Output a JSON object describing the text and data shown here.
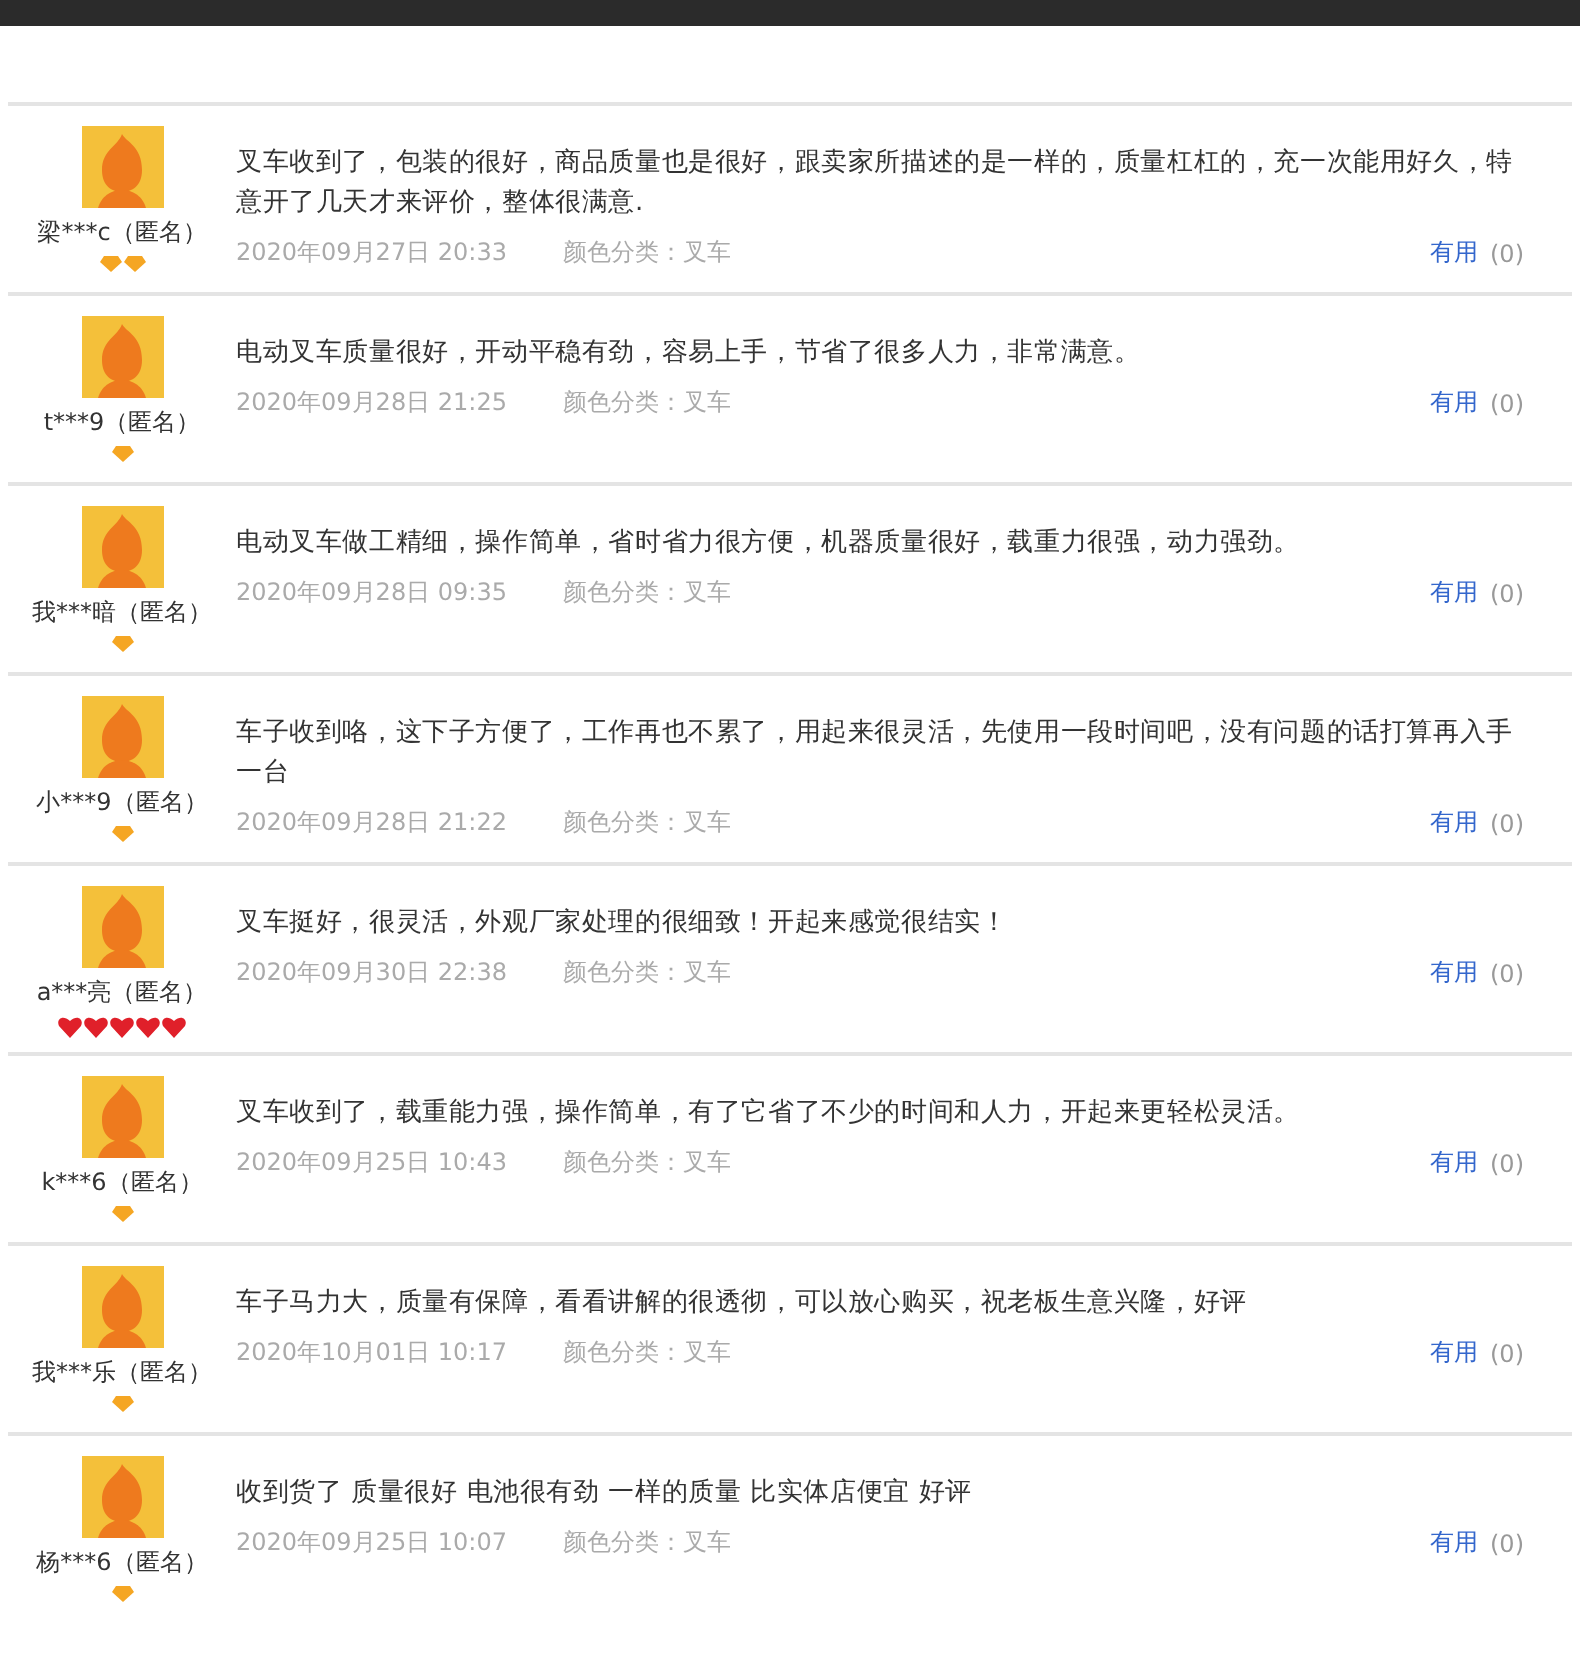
{
  "reviews": [
    {
      "user": "梁***c（匿名）",
      "badges": [
        {
          "kind": "diamond"
        },
        {
          "kind": "diamond"
        }
      ],
      "text": "叉车收到了，包装的很好，商品质量也是很好，跟卖家所描述的是一样的，质量杠杠的，充一次能用好久，特意开了几天才来评价，整体很满意.",
      "date": "2020年09月27日 20:33",
      "variant": "颜色分类：叉车",
      "useful": "有用",
      "useful_count": "(0)"
    },
    {
      "user": "t***9（匿名）",
      "badges": [
        {
          "kind": "diamond"
        }
      ],
      "text": "电动叉车质量很好，开动平稳有劲，容易上手，节省了很多人力，非常满意。",
      "date": "2020年09月28日 21:25",
      "variant": "颜色分类：叉车",
      "useful": "有用",
      "useful_count": "(0)"
    },
    {
      "user": "我***暗（匿名）",
      "badges": [
        {
          "kind": "diamond"
        }
      ],
      "text": "电动叉车做工精细，操作简单，省时省力很方便，机器质量很好，载重力很强，动力强劲。",
      "date": "2020年09月28日 09:35",
      "variant": "颜色分类：叉车",
      "useful": "有用",
      "useful_count": "(0)"
    },
    {
      "user": "小***9（匿名）",
      "badges": [
        {
          "kind": "diamond"
        }
      ],
      "text": "车子收到咯，这下子方便了，工作再也不累了，用起来很灵活，先使用一段时间吧，没有问题的话打算再入手一台",
      "date": "2020年09月28日 21:22",
      "variant": "颜色分类：叉车",
      "useful": "有用",
      "useful_count": "(0)"
    },
    {
      "user": "a***亮（匿名）",
      "badges": [
        {
          "kind": "heart"
        },
        {
          "kind": "heart"
        },
        {
          "kind": "heart"
        },
        {
          "kind": "heart"
        },
        {
          "kind": "heart"
        }
      ],
      "text": "叉车挺好，很灵活，外观厂家处理的很细致！开起来感觉很结实！",
      "date": "2020年09月30日 22:38",
      "variant": "颜色分类：叉车",
      "useful": "有用",
      "useful_count": "(0)"
    },
    {
      "user": "k***6（匿名）",
      "badges": [
        {
          "kind": "diamond"
        }
      ],
      "text": "叉车收到了，载重能力强，操作简单，有了它省了不少的时间和人力，开起来更轻松灵活。",
      "date": "2020年09月25日 10:43",
      "variant": "颜色分类：叉车",
      "useful": "有用",
      "useful_count": "(0)"
    },
    {
      "user": "我***乐（匿名）",
      "badges": [
        {
          "kind": "diamond"
        }
      ],
      "text": "车子马力大，质量有保障，看看讲解的很透彻，可以放心购买，祝老板生意兴隆，好评",
      "date": "2020年10月01日 10:17",
      "variant": "颜色分类：叉车",
      "useful": "有用",
      "useful_count": "(0)"
    },
    {
      "user": "杨***6（匿名）",
      "badges": [
        {
          "kind": "diamond"
        }
      ],
      "text": "收到货了 质量很好 电池很有劲 一样的质量 比实体店便宜 好评",
      "date": "2020年09月25日 10:07",
      "variant": "颜色分类：叉车",
      "useful": "有用",
      "useful_count": "(0)"
    }
  ]
}
